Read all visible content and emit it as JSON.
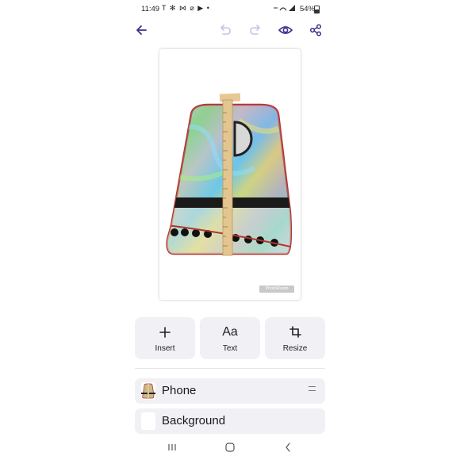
{
  "status_bar": {
    "time": "11:49",
    "notification_icons": "T ✻ ⋈ ⌀ ▶ •",
    "battery": "54%"
  },
  "toolbar": {
    "back_icon": "back-arrow-icon",
    "undo_icon": "undo-icon",
    "redo_icon": "redo-icon",
    "preview_icon": "eye-icon",
    "share_icon": "share-icon",
    "accent_color": "#3d2f8f",
    "disabled_color": "#c8c2e0"
  },
  "canvas": {
    "watermark": "PhotoRoom"
  },
  "tools": [
    {
      "label": "Insert",
      "icon": "plus-icon"
    },
    {
      "label": "Text",
      "glyph": "Aa"
    },
    {
      "label": "Resize",
      "icon": "crop-icon"
    }
  ],
  "layers": [
    {
      "name": "Phone"
    },
    {
      "name": "Background"
    }
  ]
}
